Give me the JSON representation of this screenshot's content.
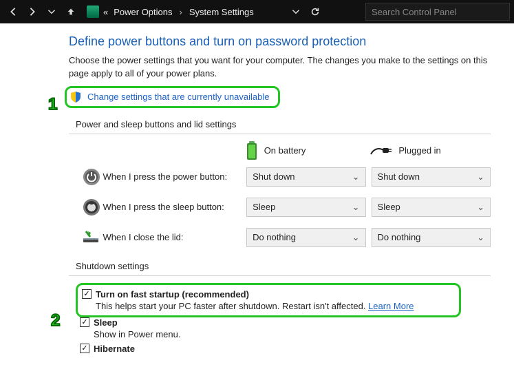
{
  "nav": {
    "crumb_prefix": "«",
    "crumb1": "Power Options",
    "crumb2": "System Settings",
    "search_placeholder": "Search Control Panel"
  },
  "page": {
    "title": "Define power buttons and turn on password protection",
    "desc": "Choose the power settings that you want for your computer. The changes you make to the settings on this page apply to all of your power plans.",
    "change_link": "Change settings that are currently unavailable"
  },
  "buttons_section": {
    "header": "Power and sleep buttons and lid settings",
    "col_battery": "On battery",
    "col_plugged": "Plugged in",
    "rows": [
      {
        "label": "When I press the power button:",
        "battery": "Shut down",
        "plugged": "Shut down"
      },
      {
        "label": "When I press the sleep button:",
        "battery": "Sleep",
        "plugged": "Sleep"
      },
      {
        "label": "When I close the lid:",
        "battery": "Do nothing",
        "plugged": "Do nothing"
      }
    ]
  },
  "shutdown": {
    "header": "Shutdown settings",
    "fast": {
      "title": "Turn on fast startup (recommended)",
      "sub": "This helps start your PC faster after shutdown. Restart isn't affected. ",
      "learn": "Learn More"
    },
    "sleep": {
      "title": "Sleep",
      "sub": "Show in Power menu."
    },
    "hibernate": {
      "title": "Hibernate"
    }
  },
  "callouts": {
    "n1": "1",
    "n2": "2"
  }
}
